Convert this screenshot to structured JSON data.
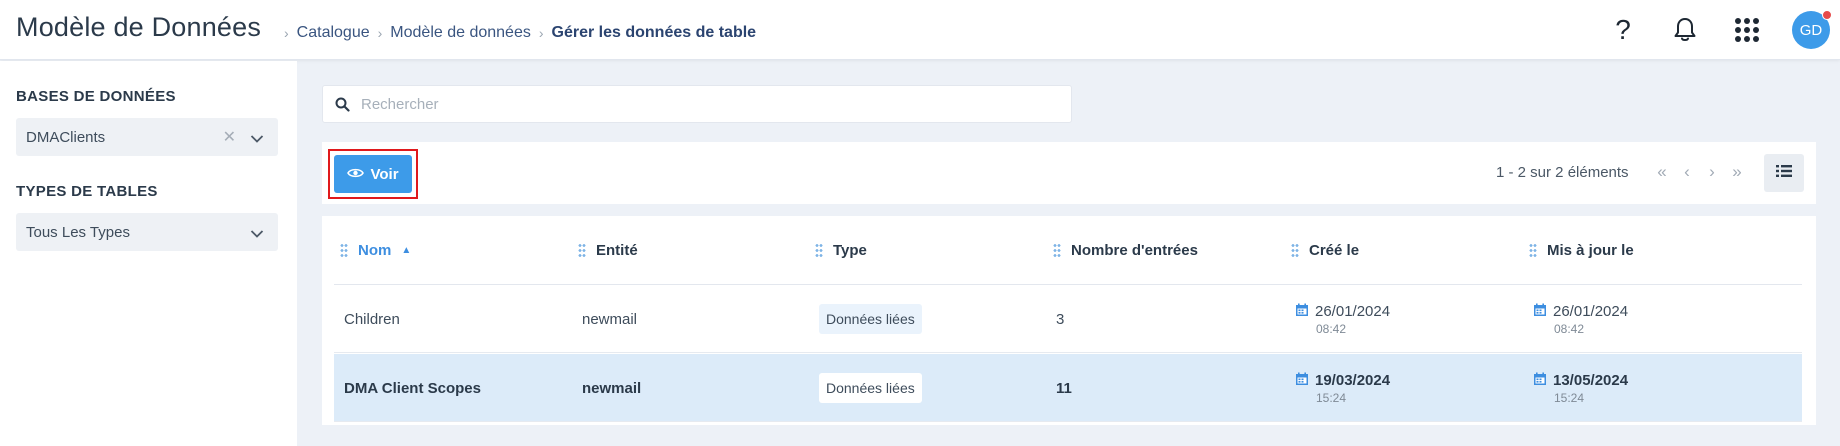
{
  "header": {
    "title": "Modèle de Données",
    "breadcrumb": [
      "Catalogue",
      "Modèle de données",
      "Gérer les données de table"
    ],
    "help_icon": "?",
    "avatar_initials": "GD"
  },
  "sidebar": {
    "databases_heading": "BASES DE DONNÉES",
    "database_value": "DMAClients",
    "table_types_heading": "TYPES DE TABLES",
    "table_type_value": "Tous Les Types"
  },
  "search": {
    "placeholder": "Rechercher"
  },
  "toolbar": {
    "voir_label": "Voir",
    "pagination_text": "1 - 2 sur 2 éléments",
    "pager_first": "«",
    "pager_prev": "‹",
    "pager_next": "›",
    "pager_last": "»"
  },
  "table": {
    "columns": [
      "Nom",
      "Entité",
      "Type",
      "Nombre d'entrées",
      "Créé le",
      "Mis à jour le"
    ],
    "rows": [
      {
        "nom": "Children",
        "entite": "newmail",
        "type": "Données liées",
        "nombre": "3",
        "cree_date": "26/01/2024",
        "cree_time": "08:42",
        "maj_date": "26/01/2024",
        "maj_time": "08:42"
      },
      {
        "nom": "DMA Client Scopes",
        "entite": "newmail",
        "type": "Données liées",
        "nombre": "11",
        "cree_date": "19/03/2024",
        "cree_time": "15:24",
        "maj_date": "13/05/2024",
        "maj_time": "15:24"
      }
    ]
  },
  "colors": {
    "accent": "#3d9be9",
    "selected_row": "#dcebf9",
    "highlight_border": "#e0191c"
  }
}
